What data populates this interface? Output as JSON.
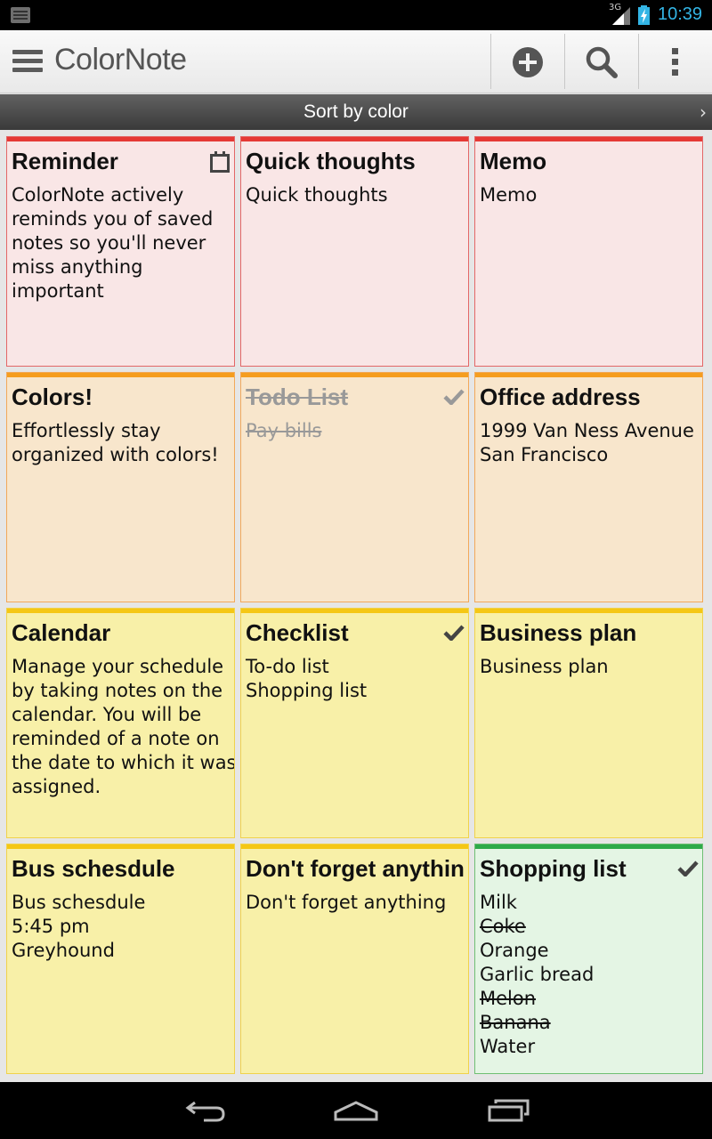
{
  "status_bar": {
    "network": "3G",
    "time": "10:39"
  },
  "app": {
    "title": "ColorNote"
  },
  "toolbar": {
    "icons": [
      "add-icon",
      "search-icon",
      "overflow-menu-icon"
    ]
  },
  "sort_bar": {
    "label": "Sort by color",
    "chevron": "›"
  },
  "colors": {
    "red": "#e53935",
    "orange": "#f59d1f",
    "yellow": "#f5c715",
    "green": "#2eaa4a",
    "time": "#33b5e5"
  },
  "notes": [
    {
      "title": "Reminder",
      "lines": [
        "ColorNote actively",
        "reminds you of saved",
        "notes so you'll never",
        "miss anything",
        "important"
      ],
      "color": "red",
      "icon": "calendar-icon"
    },
    {
      "title": "Quick thoughts",
      "lines": [
        "Quick thoughts"
      ],
      "color": "red"
    },
    {
      "title": "Memo",
      "lines": [
        "Memo"
      ],
      "color": "red"
    },
    {
      "title": "Colors!",
      "lines": [
        "Effortlessly stay",
        "organized with colors!"
      ],
      "color": "orange"
    },
    {
      "title": "Todo List",
      "lines": [
        "Pay bills"
      ],
      "color": "orange",
      "icon": "checkmark-icon",
      "completed": true
    },
    {
      "title": "Office address",
      "lines": [
        "1999 Van Ness Avenue",
        "San Francisco"
      ],
      "color": "orange"
    },
    {
      "title": "Calendar",
      "lines": [
        "Manage your schedule",
        "by taking notes on the",
        "calendar. You will be",
        "reminded of a note on",
        "the date to which it was",
        "assigned."
      ],
      "color": "yellow"
    },
    {
      "title": "Checklist",
      "lines": [
        "To-do list",
        "Shopping list"
      ],
      "color": "yellow",
      "icon": "checkmark-icon"
    },
    {
      "title": "Business plan",
      "lines": [
        "Business plan"
      ],
      "color": "yellow"
    },
    {
      "title": "Bus schesdule",
      "lines": [
        "Bus schesdule",
        "5:45 pm",
        "Greyhound"
      ],
      "color": "yellow"
    },
    {
      "title": "Don't forget anything",
      "lines": [
        "Don't forget anything"
      ],
      "color": "yellow"
    },
    {
      "title": "Shopping list",
      "lines": [
        "Milk",
        "Coke",
        "Orange",
        "Garlic bread",
        "Melon",
        "Banana",
        "Water"
      ],
      "struck_lines": [
        1,
        4,
        5
      ],
      "color": "green",
      "icon": "checkmark-icon"
    }
  ],
  "nav_bar": {
    "icons": [
      "back-icon",
      "home-icon",
      "recent-apps-icon"
    ]
  }
}
